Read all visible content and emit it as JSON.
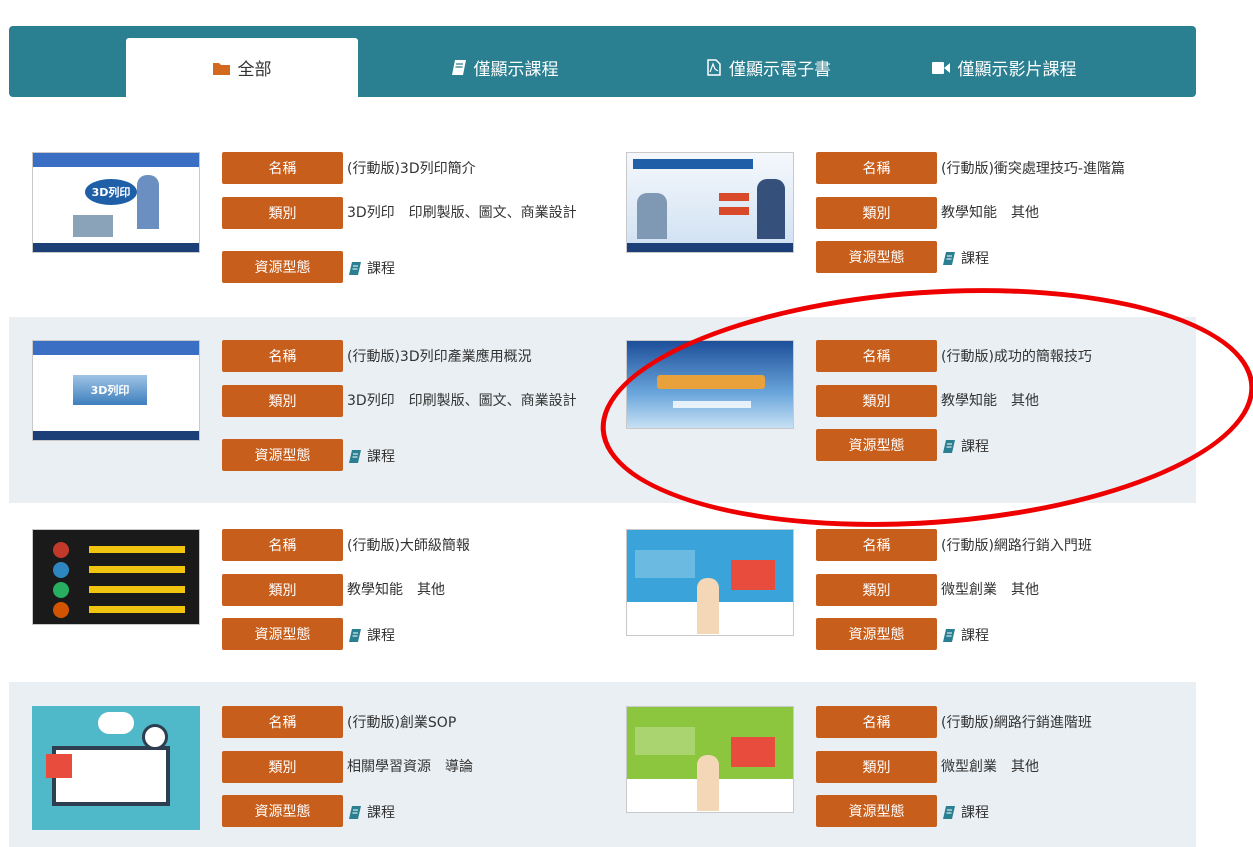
{
  "tabs": [
    {
      "label": "全部",
      "icon": "folder-icon",
      "active": true
    },
    {
      "label": "僅顯示課程",
      "icon": "book-icon",
      "active": false
    },
    {
      "label": "僅顯示電子書",
      "icon": "pdf-file-icon",
      "active": false
    },
    {
      "label": "僅顯示影片課程",
      "icon": "video-camera-icon",
      "active": false
    }
  ],
  "labels": {
    "name": "名稱",
    "category": "類別",
    "resource_type": "資源型態"
  },
  "resource_type_value": "課程",
  "courses": [
    {
      "name": "(行動版)3D列印簡介",
      "category": "3D列印　印刷製版、圖文、商業設計",
      "thumb_text": "3D列印"
    },
    {
      "name": "(行動版)衝突處理技巧-進階篇",
      "category": "教學知能　其他",
      "thumb_text": ""
    },
    {
      "name": "(行動版)3D列印產業應用概況",
      "category": "3D列印　印刷製版、圖文、商業設計",
      "thumb_text": "3D列印"
    },
    {
      "name": "(行動版)成功的簡報技巧",
      "category": "教學知能　其他",
      "thumb_text": ""
    },
    {
      "name": "(行動版)大師級簡報",
      "category": "教學知能　其他",
      "thumb_text": ""
    },
    {
      "name": "(行動版)網路行銷入門班",
      "category": "微型創業　其他",
      "thumb_text": ""
    },
    {
      "name": "(行動版)創業SOP",
      "category": "相關學習資源　導論",
      "thumb_text": ""
    },
    {
      "name": "(行動版)網路行銷進階班",
      "category": "微型創業　其他",
      "thumb_text": ""
    }
  ],
  "colors": {
    "tabbar": "#2a7f91",
    "label_bg": "#c85e1c",
    "row_shade": "#e9eff3",
    "highlight": "#ee0000",
    "icon": "#2a7f91"
  }
}
